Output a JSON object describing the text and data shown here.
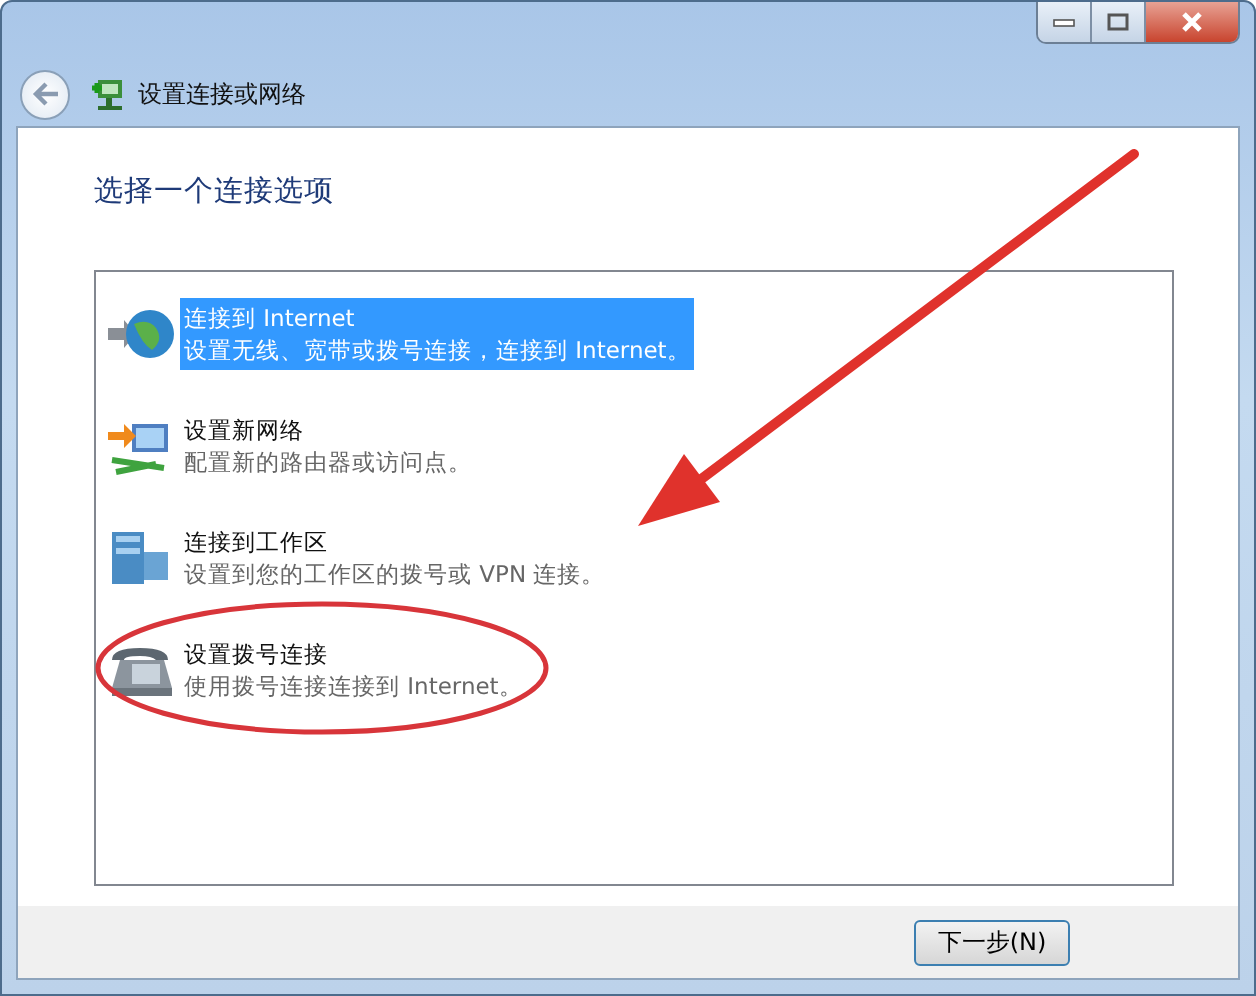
{
  "window": {
    "title": "设置连接或网络"
  },
  "heading": "选择一个连接选项",
  "options": [
    {
      "title": "连接到 Internet",
      "description": "设置无线、宽带或拨号连接，连接到 Internet。",
      "selected": true,
      "kind": "globe"
    },
    {
      "title": "设置新网络",
      "description": "配置新的路由器或访问点。",
      "selected": false,
      "kind": "network"
    },
    {
      "title": "连接到工作区",
      "description": "设置到您的工作区的拨号或 VPN 连接。",
      "selected": false,
      "kind": "workplace"
    },
    {
      "title": "设置拨号连接",
      "description": "使用拨号连接连接到 Internet。",
      "selected": false,
      "kind": "phone"
    }
  ],
  "buttons": [
    {
      "label": "下一步(N)"
    }
  ]
}
